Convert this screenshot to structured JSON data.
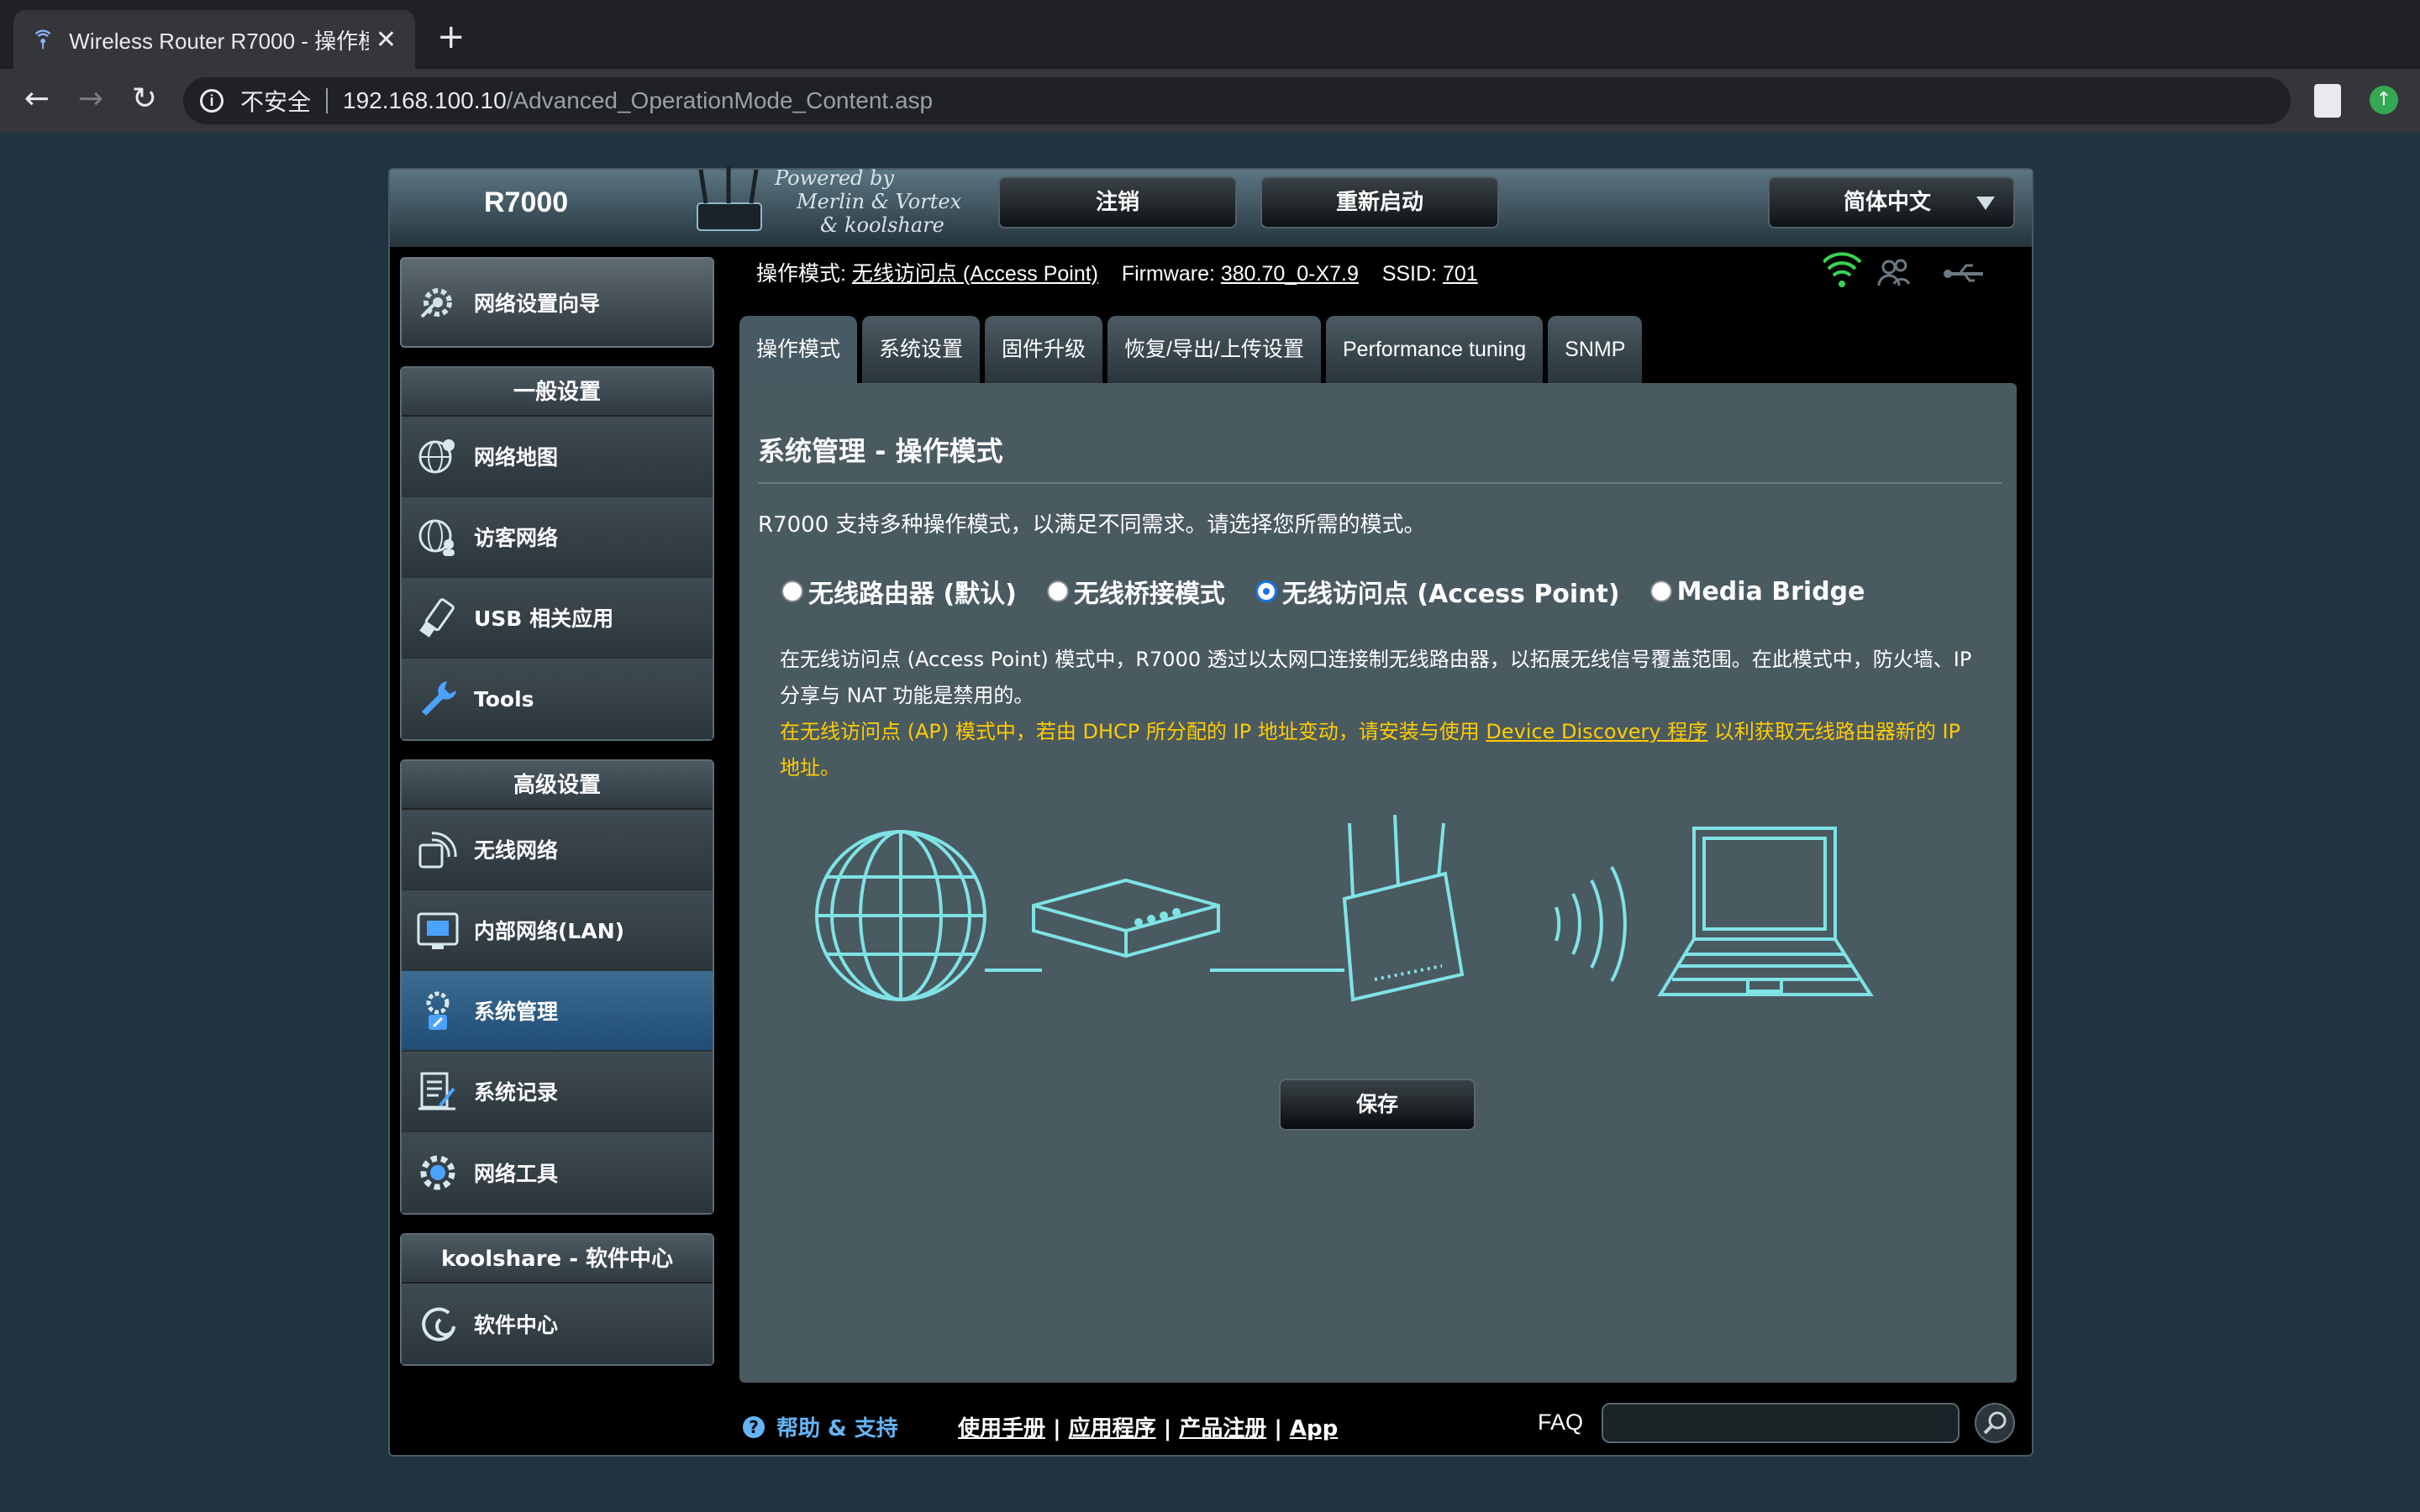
{
  "browser": {
    "tab_title": "Wireless Router R7000 - 操作模式",
    "tab_close": "✕",
    "new_tab": "+",
    "back": "←",
    "forward": "→",
    "reload": "↻",
    "security_label": "不安全",
    "url_host": "192.168.100.10",
    "url_path": "/Advanced_OperationMode_Content.asp"
  },
  "header": {
    "model": "R7000",
    "powered_by": [
      "Powered by",
      "Merlin & Vortex",
      "& koolshare"
    ],
    "logout": "注销",
    "reboot": "重新启动",
    "language": "简体中文"
  },
  "sidebar": {
    "wizard": "网络设置向导",
    "general_title": "一般设置",
    "general_items": [
      {
        "label": "网络地图",
        "icon": "globe-pin-icon"
      },
      {
        "label": "访客网络",
        "icon": "guest-globe-icon"
      },
      {
        "label": "USB 相关应用",
        "icon": "usb-icon"
      },
      {
        "label": "Tools",
        "icon": "wrench-icon"
      }
    ],
    "advanced_title": "高级设置",
    "advanced_items": [
      {
        "label": "无线网络",
        "icon": "wireless-icon"
      },
      {
        "label": "内部网络(LAN)",
        "icon": "lan-icon"
      },
      {
        "label": "系统管理",
        "icon": "admin-icon",
        "active": true
      },
      {
        "label": "系统记录",
        "icon": "log-icon"
      },
      {
        "label": "网络工具",
        "icon": "gear-icon"
      }
    ],
    "koolshare_title": "koolshare - 软件中心",
    "koolshare_items": [
      {
        "label": "软件中心",
        "icon": "swirl-icon"
      }
    ]
  },
  "status": {
    "mode_label": "操作模式:",
    "mode_value": "无线访问点 (Access Point)",
    "firmware_label": "Firmware:",
    "firmware_value": "380.70_0-X7.9",
    "ssid_label": "SSID:",
    "ssid_value": "701"
  },
  "tabs": [
    "操作模式",
    "系统设置",
    "固件升级",
    "恢复/导出/上传设置",
    "Performance tuning",
    "SNMP"
  ],
  "main": {
    "title": "系统管理 - 操作模式",
    "description": "R7000 支持多种操作模式，以满足不同需求。请选择您所需的模式。",
    "modes": [
      {
        "label": "无线路由器 (默认)",
        "selected": false
      },
      {
        "label": "无线桥接模式",
        "selected": false
      },
      {
        "label": "无线访问点 (Access Point)",
        "selected": true
      },
      {
        "label": "Media Bridge",
        "selected": false
      }
    ],
    "mode_desc": "在无线访问点 (Access Point) 模式中，R7000 透过以太网口连接制无线路由器，以拓展无线信号覆盖范围。在此模式中，防火墙、IP 分享与 NAT 功能是禁用的。",
    "warning_pre": "在无线访问点 (AP) 模式中，若由 DHCP 所分配的 IP 地址变动，请安装与使用 ",
    "warning_link": "Device Discovery 程序",
    "warning_post": " 以利获取无线路由器新的 IP 地址。",
    "save": "保存"
  },
  "footer": {
    "help_icon": "?",
    "help": "帮助 & 支持",
    "links": [
      "使用手册",
      "应用程序",
      "产品注册",
      "App"
    ],
    "faq": "FAQ"
  },
  "colors": {
    "accent_blue": "#1f4d75",
    "warning": "#ffcc00",
    "help": "#64b5f6",
    "diagram": "#7fe3e6"
  }
}
